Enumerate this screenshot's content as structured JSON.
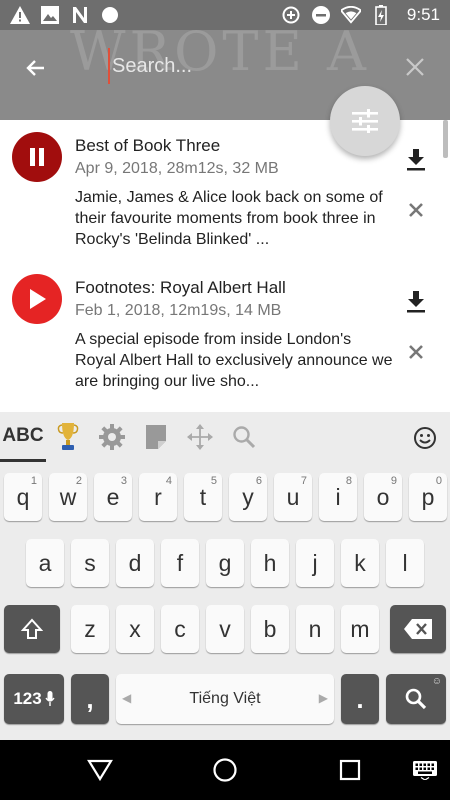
{
  "status_bar": {
    "time": "9:51",
    "left_icons": [
      "warning-icon",
      "image-icon",
      "n-app-icon",
      "circle-icon"
    ],
    "right_icons": [
      "data-saver-icon",
      "do-not-disturb-icon",
      "wifi-icon",
      "battery-charging-icon"
    ]
  },
  "header": {
    "background_text": "WROTE A",
    "search": {
      "placeholder": "Search...",
      "value": ""
    },
    "accent_color": "#e0503a"
  },
  "episodes": [
    {
      "title": "Best of Book Three",
      "meta": "Apr 9, 2018, 28m12s, 32 MB",
      "description": "Jamie, James & Alice look back on some of their favourite moments from book three in Rocky's 'Belinda Blinked' ...",
      "state": "playing",
      "button_color": "#a10d0d"
    },
    {
      "title": "Footnotes: Royal Albert Hall",
      "meta": "Feb 1, 2018, 12m19s, 14 MB",
      "description": "A special episode from inside London's Royal Albert Hall to exclusively announce we are bringing our live sho...",
      "state": "paused",
      "button_color": "#e52424"
    }
  ],
  "keyboard": {
    "toolbar": {
      "abc_label": "ABC",
      "tools": [
        "trophy-icon",
        "settings-icon",
        "clipboard-icon",
        "move-icon",
        "search-icon",
        "emoji-icon"
      ]
    },
    "row1": [
      {
        "k": "q",
        "h": "1"
      },
      {
        "k": "w",
        "h": "2"
      },
      {
        "k": "e",
        "h": "3"
      },
      {
        "k": "r",
        "h": "4"
      },
      {
        "k": "t",
        "h": "5"
      },
      {
        "k": "y",
        "h": "6"
      },
      {
        "k": "u",
        "h": "7"
      },
      {
        "k": "i",
        "h": "8"
      },
      {
        "k": "o",
        "h": "9"
      },
      {
        "k": "p",
        "h": "0"
      }
    ],
    "row2": [
      "a",
      "s",
      "d",
      "f",
      "g",
      "h",
      "j",
      "k",
      "l"
    ],
    "row3": [
      "z",
      "x",
      "c",
      "v",
      "b",
      "n",
      "m"
    ],
    "numbers_label": "123",
    "comma_label": ",",
    "space_label": "Tiếng Việt",
    "period_label": "."
  }
}
